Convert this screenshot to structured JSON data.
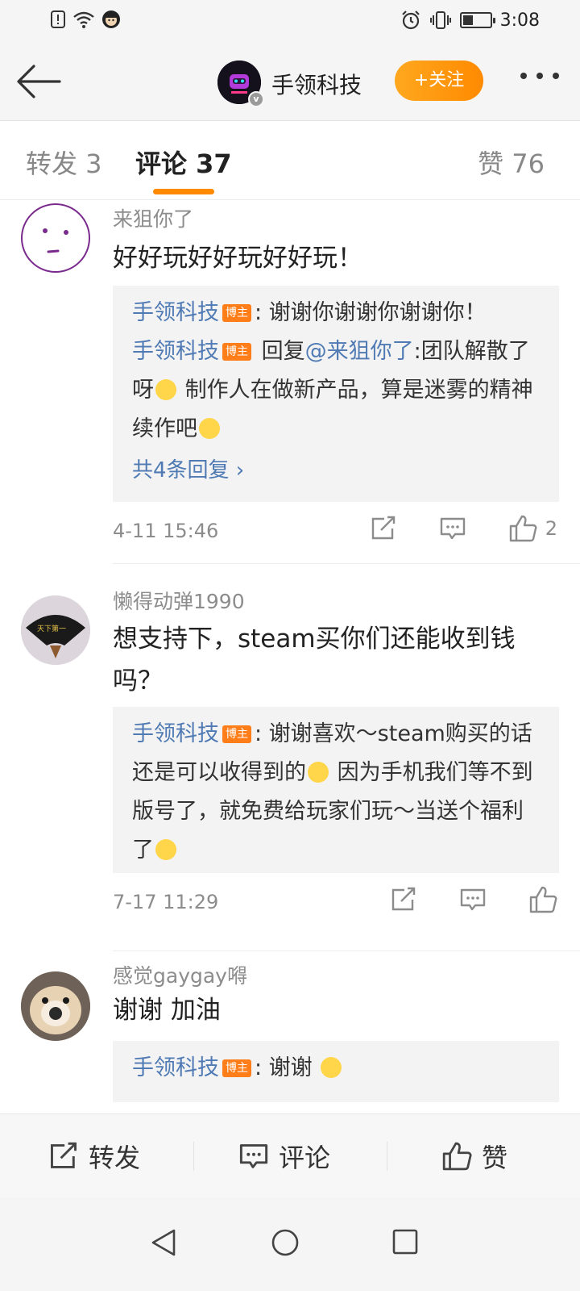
{
  "status_bar": {
    "time": "3:08"
  },
  "header": {
    "account_name": "手领科技",
    "follow_label": "+关注"
  },
  "tabs": [
    {
      "label": "转发 3"
    },
    {
      "label": "评论 37"
    },
    {
      "label": "赞 76"
    }
  ],
  "comments": [
    {
      "user": "来狙你了",
      "text": "好好玩好好玩好好玩！",
      "replies": [
        {
          "name": "手领科技",
          "badge": "博主",
          "pre": ": 谢谢你谢谢你谢谢你！"
        },
        {
          "name": "手领科技",
          "badge": "博主",
          "pre": " 回复",
          "mention": "@来狙你了",
          "post": ":团队解散了呀",
          "post2": " 制作人在做新产品，算是迷雾的精神续作吧"
        }
      ],
      "more_replies": "共4条回复 ›",
      "time": "4-11 15:46",
      "likes": "2"
    },
    {
      "user": "懒得动弹1990",
      "text": "想支持下，steam买你们还能收到钱吗？",
      "replies": [
        {
          "name": "手领科技",
          "badge": "博主",
          "pre": ": 谢谢喜欢～steam购买的话还是可以收得到的",
          "post": " 因为手机我们等不到版号了，就免费给玩家们玩～当送个福利了"
        }
      ],
      "time": "7-17 11:29",
      "likes": ""
    },
    {
      "user": "感觉gaygay嘚",
      "text": "谢谢 加油",
      "replies": [
        {
          "name": "手领科技",
          "badge": "博主",
          "pre": ": 谢谢 "
        }
      ]
    }
  ],
  "bottom_bar": {
    "repost": "转发",
    "comment": "评论",
    "like": "赞"
  },
  "colors": {
    "accent_orange": "#ff8a00",
    "link_blue": "#4f7ab4",
    "badge_orange": "#ff7e19"
  }
}
